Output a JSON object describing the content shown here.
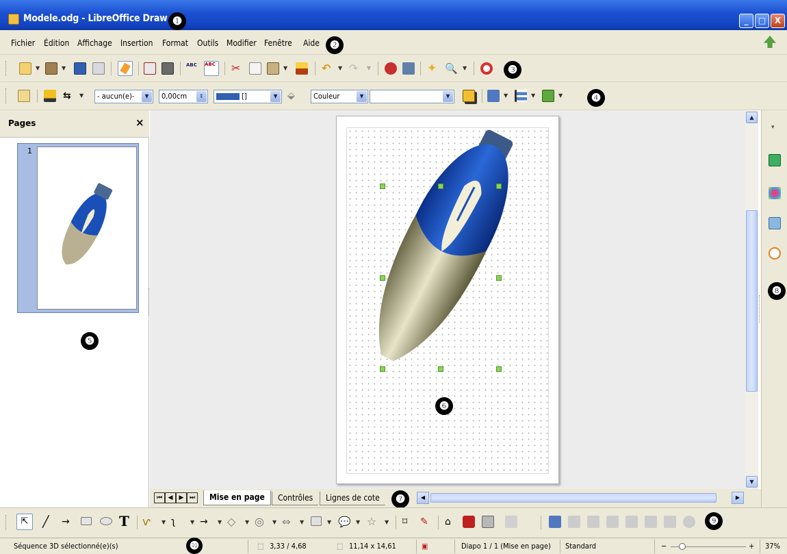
{
  "window": {
    "title": "Modele.odg - LibreOffice Draw",
    "minimize_label": "_",
    "maximize_label": "□",
    "close_label": "X"
  },
  "menu": {
    "items": [
      "Fichier",
      "Édition",
      "Affichage",
      "Insertion",
      "Format",
      "Outils",
      "Modifier",
      "Fenêtre",
      "Aide"
    ]
  },
  "line_toolbar": {
    "arrow_style": "- aucun(e)-",
    "line_width": "0,00cm",
    "line_color": "[]",
    "area_style": "Couleur",
    "area_fill": ""
  },
  "pages_panel": {
    "title": "Pages",
    "close_label": "×",
    "page_number": "1"
  },
  "tabs": {
    "items": [
      "Mise en page",
      "Contrôles",
      "Lignes de cote"
    ]
  },
  "status": {
    "selection": "Séquence 3D sélectionné(e)(s)",
    "position": "3,33 / 4,68",
    "size": "11,14 x 14,61",
    "slide": "Diapo 1 / 1 (Mise en page)",
    "master": "Standard",
    "zoom_minus": "−",
    "zoom_plus": "+",
    "zoom": "37%"
  },
  "callouts": [
    "❶",
    "❷",
    "❸",
    "❹",
    "❺",
    "❻",
    "❼",
    "❽",
    "❾",
    "❿"
  ],
  "colors": {
    "titlebar": "#1b4fd0",
    "chrome": "#ece9d8",
    "handles": "#8ed25a",
    "pen_blue": "#1a4fb8",
    "line_color_swatch": "#3060b0"
  }
}
